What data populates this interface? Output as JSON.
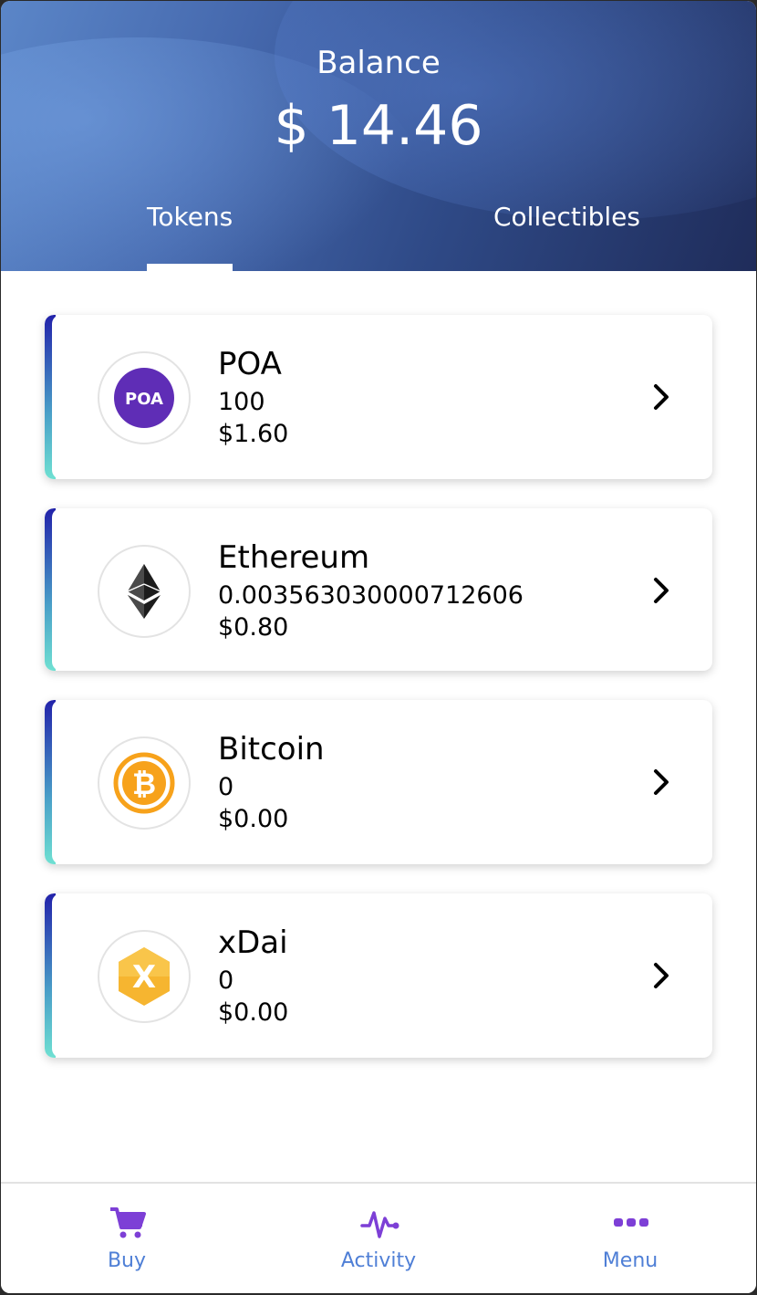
{
  "header": {
    "balance_label": "Balance",
    "balance_value": "$ 14.46",
    "tabs": [
      {
        "label": "Tokens",
        "active": true
      },
      {
        "label": "Collectibles",
        "active": false
      }
    ]
  },
  "tokens": [
    {
      "name": "POA",
      "amount": "100",
      "value": "$1.60",
      "icon": "poa-icon",
      "icon_text": "POA"
    },
    {
      "name": "Ethereum",
      "amount": "0.00356303000071 2606",
      "value": "$0.80",
      "icon": "ethereum-icon"
    },
    {
      "name": "Bitcoin",
      "amount": "0",
      "value": "$0.00",
      "icon": "bitcoin-icon"
    },
    {
      "name": "xDai",
      "amount": "0",
      "value": "$0.00",
      "icon": "xdai-icon"
    }
  ],
  "bottom_nav": [
    {
      "label": "Buy",
      "icon": "cart-icon"
    },
    {
      "label": "Activity",
      "icon": "activity-icon"
    },
    {
      "label": "Menu",
      "icon": "menu-dots-icon"
    }
  ],
  "colors": {
    "accent_blue": "#4f7fd6",
    "nav_icon_purple": "#7d3fd6",
    "poa_purple": "#5f2db6",
    "bitcoin_orange": "#f7a21b",
    "xdai_yellow": "#f6b530"
  }
}
